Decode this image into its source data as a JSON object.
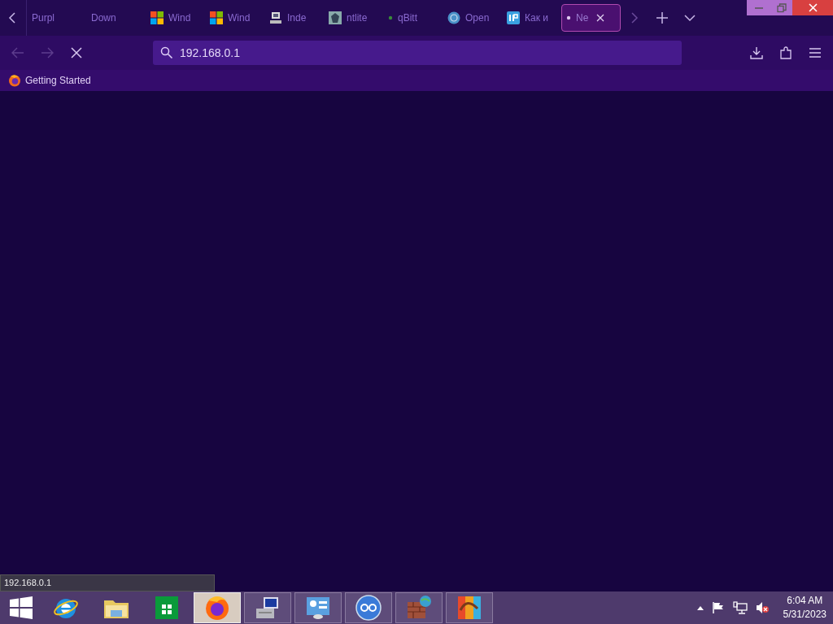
{
  "tabs": [
    {
      "label": "Purpl",
      "selected": false
    },
    {
      "label": "Down",
      "selected": false
    },
    {
      "label": "Wind",
      "selected": false
    },
    {
      "label": "Wind",
      "selected": false
    },
    {
      "label": "Inde",
      "selected": false
    },
    {
      "label": "ntlite",
      "selected": false
    },
    {
      "label": "qBitt",
      "selected": false
    },
    {
      "label": "Open",
      "selected": false
    },
    {
      "label": "Как и",
      "selected": false
    },
    {
      "label": "Ne",
      "selected": true
    }
  ],
  "navigation": {
    "back_disabled": true,
    "forward_disabled": true,
    "loading": true
  },
  "address_bar": {
    "value": "192.168.0.1"
  },
  "bookmarks": [
    {
      "label": "Getting Started"
    }
  ],
  "status_text": "192.168.0.1",
  "taskbar": {
    "apps": [
      {
        "running": false,
        "selected": false
      },
      {
        "running": false,
        "selected": false
      },
      {
        "running": false,
        "selected": false
      },
      {
        "running": true,
        "selected": true
      },
      {
        "running": true,
        "selected": false
      },
      {
        "running": true,
        "selected": false
      },
      {
        "running": true,
        "selected": false
      },
      {
        "running": true,
        "selected": false
      },
      {
        "running": true,
        "selected": false
      }
    ],
    "time": "6:04 AM",
    "date": "5/31/2023"
  }
}
